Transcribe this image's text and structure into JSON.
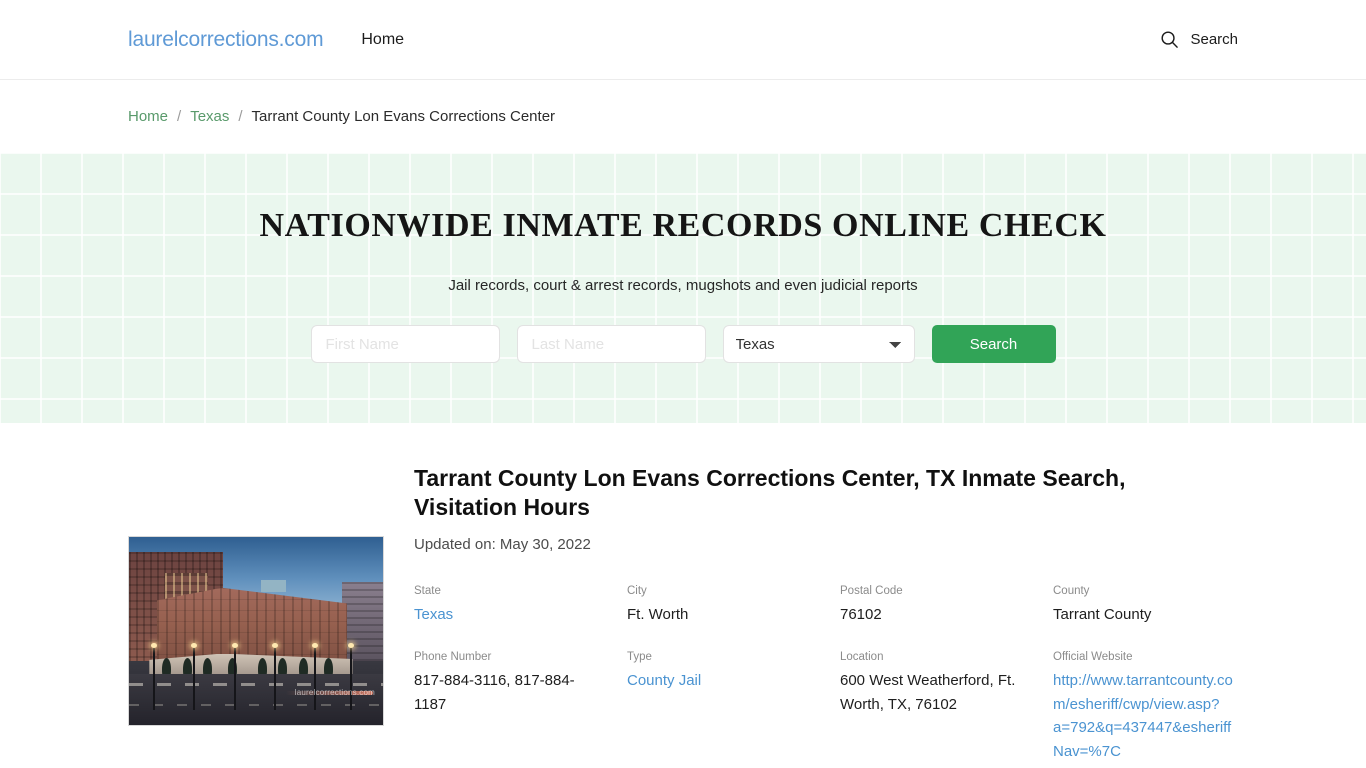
{
  "header": {
    "brand": "laurelcorrections.com",
    "nav": [
      {
        "label": "Home"
      }
    ],
    "search": {
      "label": "Search",
      "icon": "search-icon"
    }
  },
  "breadcrumb": {
    "items": [
      {
        "label": "Home",
        "type": "link"
      },
      {
        "label": "Texas",
        "type": "link"
      },
      {
        "label": "Tarrant County Lon Evans Corrections Center",
        "type": "current"
      }
    ],
    "separator": "/"
  },
  "hero": {
    "title": "NATIONWIDE INMATE RECORDS ONLINE CHECK",
    "subtitle": "Jail records, court & arrest records, mugshots and even judicial reports",
    "form": {
      "first_name_placeholder": "First Name",
      "first_name_value": "",
      "last_name_placeholder": "Last Name",
      "last_name_value": "",
      "state_selected": "Texas",
      "state_options": [
        "Texas"
      ],
      "submit_label": "Search"
    },
    "background_color": "#eaf7ee",
    "accent_color": "#31a457"
  },
  "main": {
    "photo": {
      "alt": "Tarrant County Lon Evans Corrections Center building at dusk",
      "watermark": "laurelcorrections.com"
    },
    "title": "Tarrant County Lon Evans Corrections Center, TX Inmate Search, Visitation Hours",
    "updated": "Updated on: May 30, 2022",
    "facts": [
      {
        "label": "State",
        "value": "Texas",
        "link": true
      },
      {
        "label": "City",
        "value": "Ft. Worth",
        "link": false
      },
      {
        "label": "Postal Code",
        "value": "76102",
        "link": false
      },
      {
        "label": "County",
        "value": "Tarrant County",
        "link": false
      },
      {
        "label": "Phone Number",
        "value": "817-884-3116, 817-884-1187",
        "link": false
      },
      {
        "label": "Type",
        "value": "County Jail",
        "link": true
      },
      {
        "label": "Location",
        "value": "600 West Weatherford, Ft. Worth, TX, 76102",
        "link": false
      },
      {
        "label": "Official Website",
        "value": "http://www.tarrantcounty.com/esheriff/cwp/view.asp?a=792&q=437447&esheriffNav=%7C",
        "link": true
      }
    ]
  }
}
